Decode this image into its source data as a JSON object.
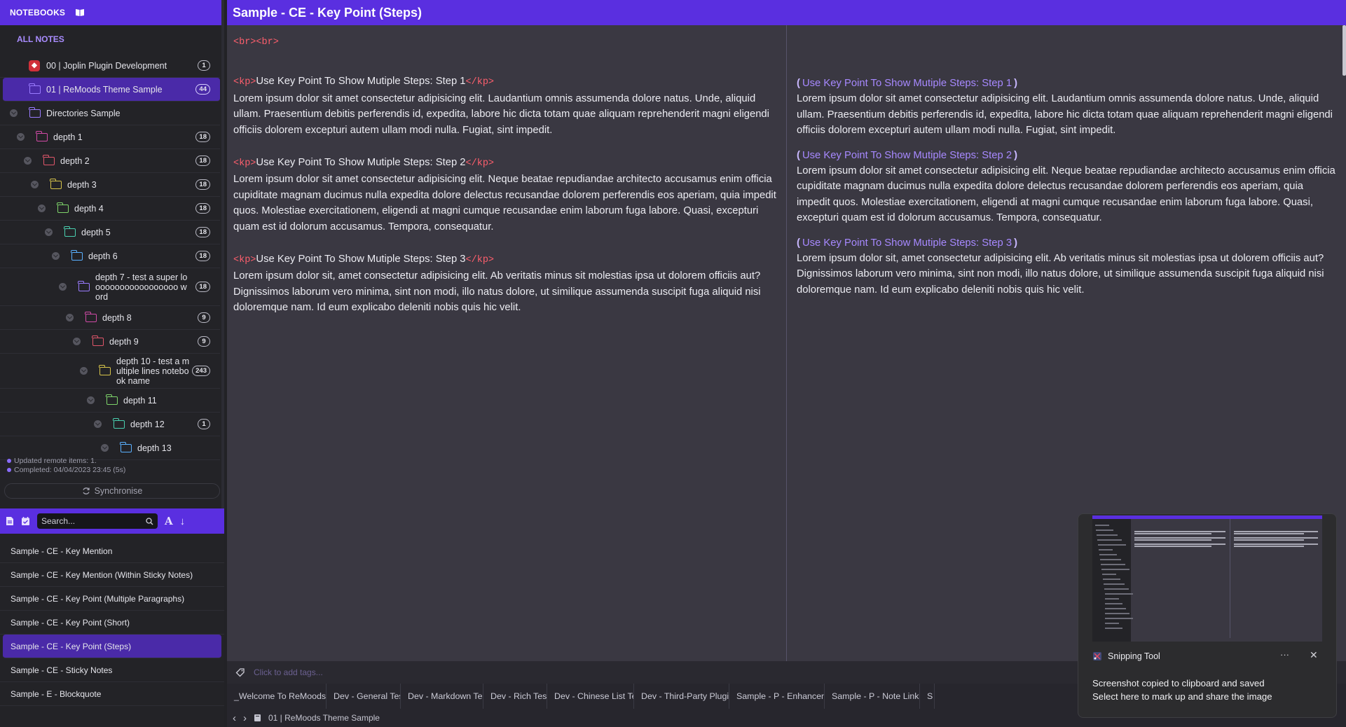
{
  "sidebar": {
    "header": "NOTEBOOKS",
    "all_notes": "ALL NOTES",
    "notebooks": [
      {
        "label": "00 | Joplin Plugin Development",
        "count": "1"
      },
      {
        "label": "01 | ReMoods Theme Sample",
        "count": "44"
      },
      {
        "label": "Directories Sample",
        "count": ""
      },
      {
        "label": "depth 1",
        "count": "18"
      },
      {
        "label": "depth 2",
        "count": "18"
      },
      {
        "label": "depth 3",
        "count": "18"
      },
      {
        "label": "depth 4",
        "count": "18"
      },
      {
        "label": "depth 5",
        "count": "18"
      },
      {
        "label": "depth 6",
        "count": "18"
      },
      {
        "label": "depth 7 - test a super loooooooooooooooooo word",
        "count": "18"
      },
      {
        "label": "depth 8",
        "count": "9"
      },
      {
        "label": "depth 9",
        "count": "9"
      },
      {
        "label": "depth 10 - test a multiple lines notebook name",
        "count": "243"
      },
      {
        "label": "depth 11",
        "count": ""
      },
      {
        "label": "depth 12",
        "count": "1"
      },
      {
        "label": "depth 13",
        "count": ""
      }
    ],
    "sync_status_1": "Updated remote items: 1.",
    "sync_status_2": "Completed: 04/04/2023 23:45 (5s)",
    "sync_button": "Synchronise"
  },
  "notelist": {
    "search_placeholder": "Search...",
    "notes": [
      "Sample - CE - Key Mention",
      "Sample - CE - Key Mention (Within Sticky Notes)",
      "Sample - CE - Key Point (Multiple Paragraphs)",
      "Sample - CE - Key Point (Short)",
      "Sample - CE - Key Point (Steps)",
      "Sample - CE - Sticky Notes",
      "Sample - E - Blockquote"
    ]
  },
  "editor": {
    "title": "Sample - CE - Key Point (Steps)",
    "br_line": "<br><br>",
    "kp_open": "<kp>",
    "kp_close": "</kp>",
    "steps": [
      {
        "heading": "Use Key Point To Show Mutiple Steps: Step 1",
        "body": "Lorem ipsum dolor sit amet consectetur adipisicing elit. Laudantium omnis assumenda dolore natus. Unde, aliquid ullam. Praesentium debitis perferendis id, expedita, labore hic dicta totam quae aliquam reprehenderit magni eligendi officiis dolorem excepturi autem ullam modi nulla. Fugiat, sint impedit."
      },
      {
        "heading": "Use Key Point To Show Mutiple Steps: Step 2",
        "body": "Lorem ipsum dolor sit amet consectetur adipisicing elit. Neque beatae repudiandae architecto accusamus enim officia cupiditate magnam ducimus nulla expedita dolore delectus recusandae dolorem perferendis eos aperiam, quia impedit quos. Molestiae exercitationem, eligendi at magni cumque recusandae enim laborum fuga labore. Quasi, excepturi quam est id dolorum accusamus. Tempora, consequatur."
      },
      {
        "heading": "Use Key Point To Show Mutiple Steps: Step 3",
        "body": "Lorem ipsum dolor sit, amet consectetur adipisicing elit. Ab veritatis minus sit molestias ipsa ut dolorem officiis aut? Dignissimos laborum vero minima, sint non modi, illo natus dolore, ut similique assumenda suscipit fuga aliquid nisi doloremque nam. Id eum explicabo deleniti nobis quis hic velit."
      }
    ],
    "tag_placeholder": "Click to add tags...",
    "tabs": [
      "_Welcome To ReMoods...",
      "Dev - General Test",
      "Dev - Markdown Test",
      "Dev - Rich Test",
      "Dev - Chinese List Test",
      "Dev - Third-Party Plugin...",
      "Sample - P - Enhancem...",
      "Sample - P - Note Link ...",
      "S"
    ],
    "breadcrumb": "01 | ReMoods Theme Sample"
  },
  "toast": {
    "app": "Snipping Tool",
    "line1": "Screenshot copied to clipboard and saved",
    "line2": "Select here to mark up and share the image",
    "dots": "···",
    "close": "✕"
  },
  "colors": {
    "accent": "#5a2fe0",
    "selected": "#4a2aa8",
    "code_red": "#ff5f6d",
    "kp_purple": "#a789ff"
  }
}
